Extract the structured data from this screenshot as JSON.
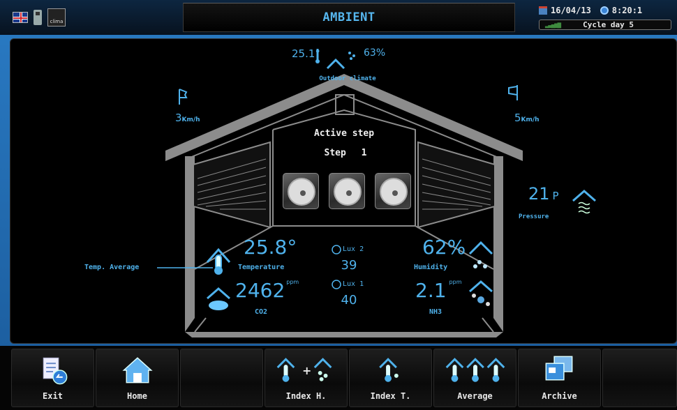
{
  "header": {
    "title": "AMBIENT",
    "date": "16/04/13",
    "time": "8:20:1",
    "cycle_day": "Cycle day 5",
    "clima_label": "clima"
  },
  "outdoor": {
    "temperature": "25.1°",
    "humidity": "63%",
    "label": "Outdoor climate"
  },
  "wind": {
    "left_value": "3",
    "right_value": "5",
    "unit": "Km/h"
  },
  "ventilation": {
    "active_step_label": "Active step",
    "step_label": "Step",
    "step_value": "1",
    "fans_count": 3
  },
  "pressure": {
    "value": "21",
    "unit": "P",
    "label": "Pressure"
  },
  "readings": {
    "temp_average_label": "Temp. Average",
    "temperature_value": "25.8°",
    "temperature_label": "Temperature",
    "co2_value": "2462",
    "co2_unit": "ppm",
    "co2_label": "CO2",
    "lux2_label": "Lux 2",
    "lux2_value": "39",
    "lux1_label": "Lux 1",
    "lux1_value": "40",
    "humidity_value": "62%",
    "humidity_label": "Humidity",
    "nh3_value": "2.1",
    "nh3_unit": "ppm",
    "nh3_label": "NH3"
  },
  "nav": [
    {
      "label": "Exit",
      "icon": "exit-icon"
    },
    {
      "label": "Home",
      "icon": "home-icon"
    },
    {
      "label": "",
      "icon": ""
    },
    {
      "label": "Index H.",
      "icon": "index-h-icon"
    },
    {
      "label": "Index T.",
      "icon": "index-t-icon"
    },
    {
      "label": "Average",
      "icon": "average-icon"
    },
    {
      "label": "Archive",
      "icon": "archive-icon"
    },
    {
      "label": "",
      "icon": ""
    }
  ],
  "colors": {
    "accent": "#4fb2ec",
    "house": "#8c8c8c",
    "frame_blue": "#2a7bc4"
  }
}
